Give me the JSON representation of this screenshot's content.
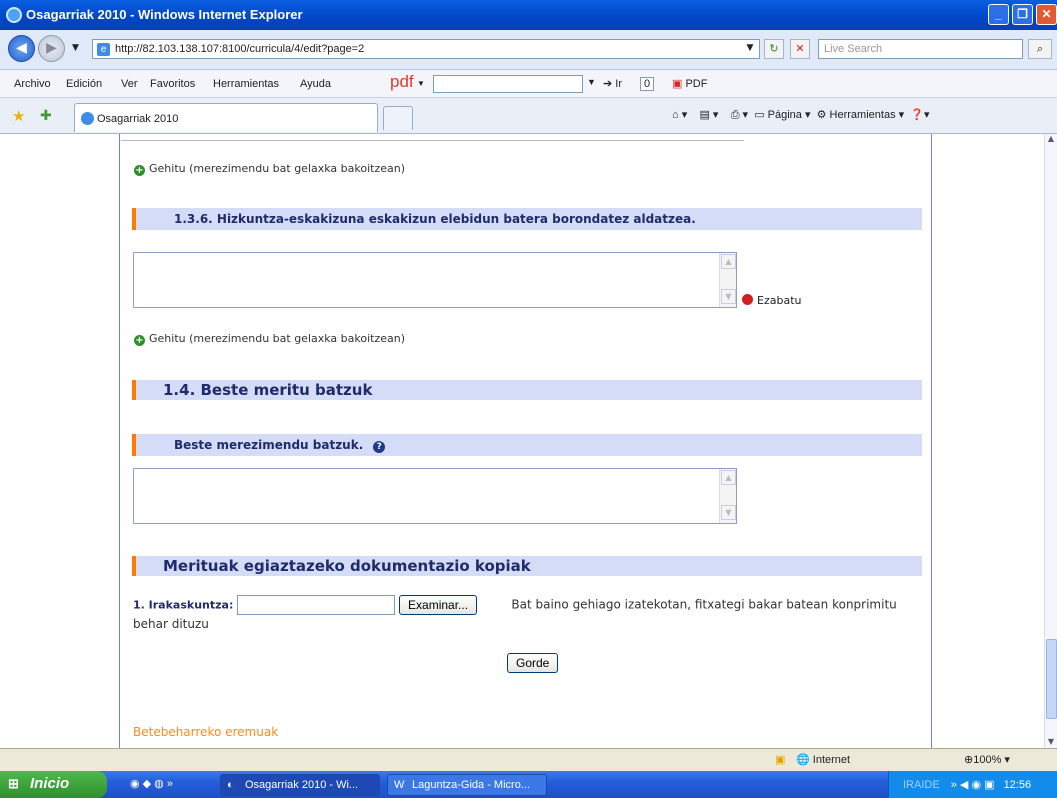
{
  "window": {
    "title": "Osagarriak 2010 - Windows Internet Explorer"
  },
  "address": {
    "url": "http://82.103.138.107:8100/curricula/4/edit?page=2",
    "search_placeholder": "Live Search"
  },
  "menu": [
    "Archivo",
    "Edición",
    "Ver",
    "Favoritos",
    "Herramientas",
    "Ayuda"
  ],
  "pdf_toolbar": {
    "label": "pdf",
    "go": "Ir",
    "count": "0",
    "pdf": "PDF"
  },
  "tab": {
    "label": "Osagarriak 2010"
  },
  "command_bar": {
    "page": "Página",
    "tools": "Herramientas"
  },
  "page": {
    "add_label": "Gehitu (merezimendu bat gelaxka bakoitzean)",
    "add_label_2": "Gehitu (merezimendu bat gelaxka bakoitzean)",
    "section_136": "1.3.6. Hizkuntza-eskakizuna eskakizun elebidun batera borondatez aldatzea.",
    "delete_label": "Ezabatu",
    "section_14": "1.4. Beste meritu batzuk",
    "other_merits": "Beste merezimendu batzuk.",
    "docs_title": "Merituak egiaztazeko dokumentazio kopiak",
    "teaching_label": "1. Irakaskuntza:",
    "browse_button": "Examinar...",
    "upload_hint": "Bat baino gehiago izatekotan, fitxategi bakar batean konprimitu behar dituzu",
    "save_button": "Gorde",
    "required_fields": "Betebeharreko eremuak"
  },
  "status": {
    "zone": "Internet",
    "zoom": "100%"
  },
  "taskbar": {
    "start": "Inicio",
    "task1": "Osagarriak 2010 - Wi...",
    "task2": "Laguntza-Gida - Micro...",
    "user": "IRAIDE",
    "time": "12:56"
  }
}
